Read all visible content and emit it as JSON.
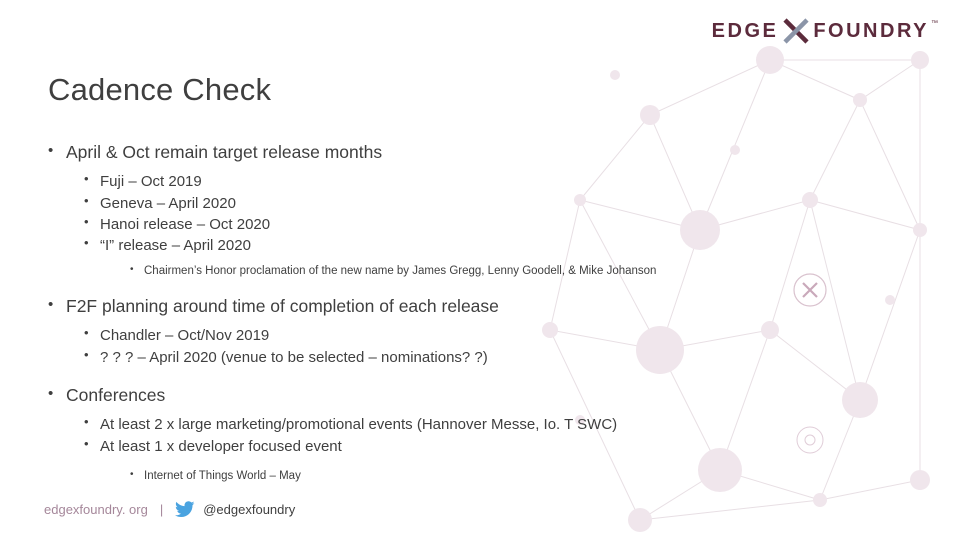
{
  "logo": {
    "left_text": "EDGE",
    "right_text": "FOUNDRY",
    "tm": "™",
    "x_icon": "x-mark-icon",
    "color": "#5c2b3c"
  },
  "title": "Cadence Check",
  "bullets": [
    {
      "level": 1,
      "text": "April & Oct remain target release months"
    },
    {
      "level": 2,
      "text": "Fuji – Oct 2019"
    },
    {
      "level": 2,
      "text": "Geneva – April 2020"
    },
    {
      "level": 2,
      "text": "Hanoi release – Oct 2020"
    },
    {
      "level": 2,
      "text": "“I” release – April 2020"
    },
    {
      "level": 3,
      "text": "Chairmen’s Honor proclamation of the new name by James Gregg, Lenny Goodell, & Mike Johanson"
    },
    {
      "level": 1,
      "text": "F2F planning around time of completion of each release"
    },
    {
      "level": 2,
      "text": "Chandler – Oct/Nov 2019"
    },
    {
      "level": 2,
      "text": "? ? ? – April 2020 (venue to be selected – nominations? ?)"
    },
    {
      "level": 1,
      "text": "Conferences"
    },
    {
      "level": 2,
      "text": "At least 2 x large marketing/promotional events (Hannover Messe, Io. T SWC)"
    },
    {
      "level": 2,
      "text": "At least 1 x developer focused event"
    },
    {
      "level": 3,
      "text": "Internet of Things World – May"
    }
  ],
  "footer": {
    "site": "edgexfoundry. org",
    "separator": "|",
    "twitter_icon": "twitter-bird-icon",
    "handle": "@edgexfoundry",
    "site_color": "#a5879a"
  }
}
